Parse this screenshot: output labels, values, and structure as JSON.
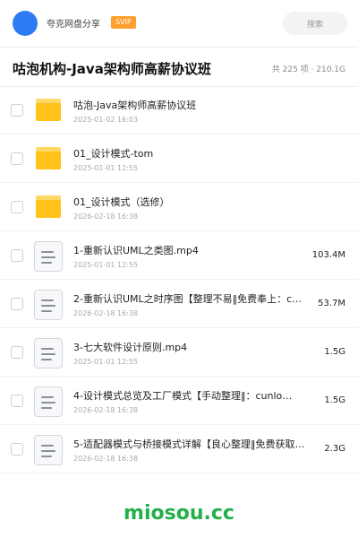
{
  "header": {
    "app_name": "夸克网盘分享",
    "badge": "SVIP",
    "search_placeholder": "搜索",
    "avatar_color": "#2d7cf6",
    "badge_color": "#ff9d2e"
  },
  "title_bar": {
    "title": "咕泡机构-Java架构师高薪协议班",
    "summary": "共 225 项 · 210.1G"
  },
  "files": [
    {
      "type": "folder",
      "name": "咕泡-Java架构师高薪协议班",
      "date": "2025-01-02 16:03",
      "size": ""
    },
    {
      "type": "folder",
      "name": "01_设计模式-tom",
      "date": "2025-01-01 12:55",
      "size": ""
    },
    {
      "type": "folder",
      "name": "01_设计模式（选修）",
      "date": "2026-02-18 16:38",
      "size": ""
    },
    {
      "type": "file",
      "name": "1-重新认识UML之类图.mp4",
      "date": "2025-01-01 12:55",
      "size": "103.4M"
    },
    {
      "type": "file",
      "name": "2-重新认识UML之时序图【整理不易‖免费奉上：c…",
      "date": "2026-02-18 16:38",
      "size": "53.7M"
    },
    {
      "type": "file",
      "name": "3-七大软件设计原则.mp4",
      "date": "2025-01-01 12:55",
      "size": "1.5G"
    },
    {
      "type": "file",
      "name": "4-设计模式总览及工厂模式【手动整理‖：cunlo…",
      "date": "2026-02-18 16:38",
      "size": "1.5G"
    },
    {
      "type": "file",
      "name": "5-适配器模式与桥接模式详解【良心整理‖免费获取：…",
      "date": "2026-02-18 16:38",
      "size": "2.3G"
    }
  ],
  "watermark": "miosou.cc",
  "colors": {
    "folder": "#ffc21a",
    "watermark": "#22b04a"
  }
}
